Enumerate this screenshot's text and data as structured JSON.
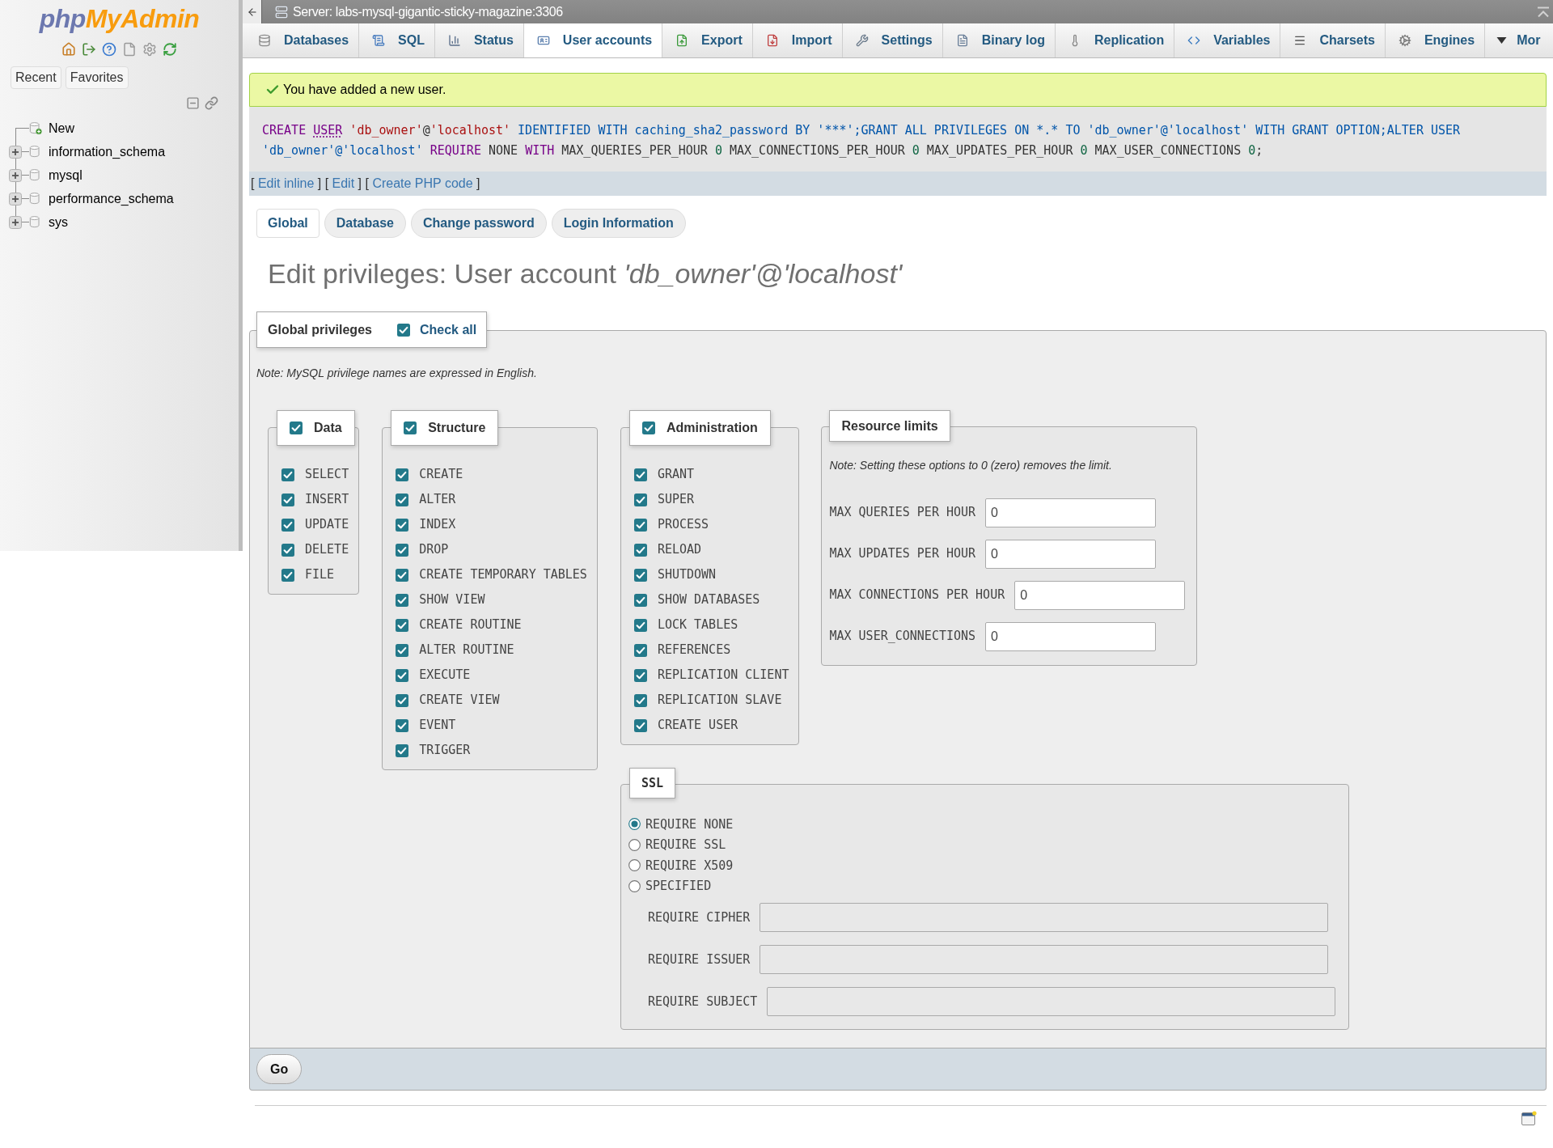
{
  "sidebar": {
    "logo": {
      "prefix": "php",
      "name": "MyAdmin"
    },
    "tabs": [
      "Recent",
      "Favorites"
    ],
    "tree": [
      {
        "label": "New",
        "kind": "new"
      },
      {
        "label": "information_schema",
        "kind": "database",
        "expanded": false
      },
      {
        "label": "mysql",
        "kind": "database",
        "expanded": false
      },
      {
        "label": "performance_schema",
        "kind": "database",
        "expanded": false
      },
      {
        "label": "sys",
        "kind": "database",
        "expanded": false
      }
    ]
  },
  "server_bar": {
    "title": "Server: labs-mysql-gigantic-sticky-magazine:3306"
  },
  "nav_tabs": [
    {
      "label": "Databases",
      "kind": "page",
      "selected": false
    },
    {
      "label": "SQL",
      "kind": "page",
      "selected": false
    },
    {
      "label": "Status",
      "kind": "page",
      "selected": false
    },
    {
      "label": "User accounts",
      "kind": "page",
      "selected": true
    },
    {
      "label": "Export",
      "kind": "page",
      "selected": false
    },
    {
      "label": "Import",
      "kind": "page",
      "selected": false
    },
    {
      "label": "Settings",
      "kind": "page",
      "selected": false
    },
    {
      "label": "Binary log",
      "kind": "page",
      "selected": false
    },
    {
      "label": "Replication",
      "kind": "page",
      "selected": false
    },
    {
      "label": "Variables",
      "kind": "page",
      "selected": false
    },
    {
      "label": "Charsets",
      "kind": "page",
      "selected": false
    },
    {
      "label": "Engines",
      "kind": "page",
      "selected": false
    },
    {
      "label": "Mor",
      "kind": "menu",
      "selected": false
    }
  ],
  "notice": {
    "message": "You have added a new user."
  },
  "sql_query": {
    "tokens": [
      {
        "text": "CREATE ",
        "kind": "keyword"
      },
      {
        "text": "USER",
        "kind": "doc_link"
      },
      {
        "text": " 'db_owner'",
        "kind": "string"
      },
      {
        "text": "@",
        "kind": "plain"
      },
      {
        "text": "'localhost'",
        "kind": "string"
      },
      {
        "text": " IDENTIFIED WITH caching_sha2_password BY '***';GRANT ALL PRIVILEGES ON *.* TO 'db_owner'@'localhost' WITH GRANT OPTION;ALTER USER 'db_owner'@'localhost'",
        "kind": "variable"
      },
      {
        "text": " REQUIRE",
        "kind": "keyword"
      },
      {
        "text": " NONE ",
        "kind": "plain"
      },
      {
        "text": "WITH",
        "kind": "keyword"
      },
      {
        "text": " MAX_QUERIES_PER_HOUR ",
        "kind": "plain"
      },
      {
        "text": "0",
        "kind": "number"
      },
      {
        "text": " MAX_CONNECTIONS_PER_HOUR ",
        "kind": "plain"
      },
      {
        "text": "0",
        "kind": "number"
      },
      {
        "text": " MAX_UPDATES_PER_HOUR ",
        "kind": "plain"
      },
      {
        "text": "0",
        "kind": "number"
      },
      {
        "text": " MAX_USER_CONNECTIONS ",
        "kind": "plain"
      },
      {
        "text": "0",
        "kind": "number"
      },
      {
        "text": ";",
        "kind": "plain"
      }
    ]
  },
  "query_actions": [
    {
      "open": "[",
      "link": "Edit inline",
      "close": "]"
    },
    {
      "open": "[",
      "link": "Edit",
      "close": "]"
    },
    {
      "open": "[",
      "link": "Create PHP code",
      "close": "]"
    }
  ],
  "subtabs": [
    {
      "label": "Global",
      "selected": true
    },
    {
      "label": "Database",
      "selected": false
    },
    {
      "label": "Change password",
      "selected": false
    },
    {
      "label": "Login Information",
      "selected": false
    }
  ],
  "heading": "Edit privileges: User account *'db_owner'@'localhost'*",
  "global_privileges": {
    "title": "Global privileges",
    "check_all": {
      "label": "Check all",
      "checked": true
    },
    "note": "Note: MySQL privilege names are expressed in English.",
    "groups": [
      {
        "title": "Data",
        "checked": true,
        "privileges": [
          {
            "name": "SELECT",
            "checked": true
          },
          {
            "name": "INSERT",
            "checked": true
          },
          {
            "name": "UPDATE",
            "checked": true
          },
          {
            "name": "DELETE",
            "checked": true
          },
          {
            "name": "FILE",
            "checked": true
          }
        ]
      },
      {
        "title": "Structure",
        "checked": true,
        "privileges": [
          {
            "name": "CREATE",
            "checked": true
          },
          {
            "name": "ALTER",
            "checked": true
          },
          {
            "name": "INDEX",
            "checked": true
          },
          {
            "name": "DROP",
            "checked": true
          },
          {
            "name": "CREATE TEMPORARY TABLES",
            "checked": true
          },
          {
            "name": "SHOW VIEW",
            "checked": true
          },
          {
            "name": "CREATE ROUTINE",
            "checked": true
          },
          {
            "name": "ALTER ROUTINE",
            "checked": true
          },
          {
            "name": "EXECUTE",
            "checked": true
          },
          {
            "name": "CREATE VIEW",
            "checked": true
          },
          {
            "name": "EVENT",
            "checked": true
          },
          {
            "name": "TRIGGER",
            "checked": true
          }
        ]
      },
      {
        "title": "Administration",
        "checked": true,
        "privileges": [
          {
            "name": "GRANT",
            "checked": true
          },
          {
            "name": "SUPER",
            "checked": true
          },
          {
            "name": "PROCESS",
            "checked": true
          },
          {
            "name": "RELOAD",
            "checked": true
          },
          {
            "name": "SHUTDOWN",
            "checked": true
          },
          {
            "name": "SHOW DATABASES",
            "checked": true
          },
          {
            "name": "LOCK TABLES",
            "checked": true
          },
          {
            "name": "REFERENCES",
            "checked": true
          },
          {
            "name": "REPLICATION CLIENT",
            "checked": true
          },
          {
            "name": "REPLICATION SLAVE",
            "checked": true
          },
          {
            "name": "CREATE USER",
            "checked": true
          }
        ]
      }
    ],
    "resource_limits": {
      "title": "Resource limits",
      "note": "Note: Setting these options to 0 (zero) removes the limit.",
      "fields": [
        {
          "label": "MAX QUERIES PER HOUR",
          "value": "0"
        },
        {
          "label": "MAX UPDATES PER HOUR",
          "value": "0"
        },
        {
          "label": "MAX CONNECTIONS PER HOUR",
          "value": "0"
        },
        {
          "label": "MAX USER_CONNECTIONS",
          "value": "0"
        }
      ]
    },
    "ssl": {
      "title": "SSL",
      "options": [
        {
          "label": "REQUIRE NONE",
          "selected": true
        },
        {
          "label": "REQUIRE SSL",
          "selected": false
        },
        {
          "label": "REQUIRE X509",
          "selected": false
        },
        {
          "label": "SPECIFIED",
          "selected": false
        }
      ],
      "fields": [
        {
          "label": "REQUIRE CIPHER",
          "disabled": true
        },
        {
          "label": "REQUIRE ISSUER",
          "disabled": true
        },
        {
          "label": "REQUIRE SUBJECT",
          "disabled": true
        }
      ]
    }
  },
  "submit": {
    "label": "Go"
  }
}
